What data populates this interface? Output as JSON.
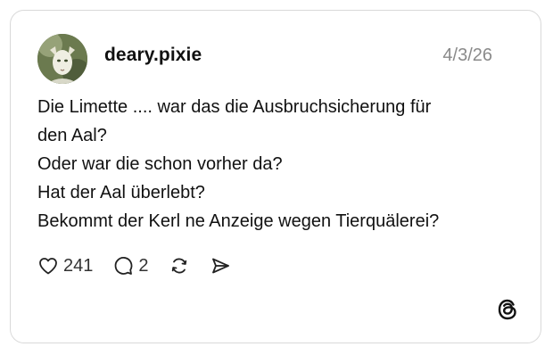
{
  "post": {
    "username": "deary.pixie",
    "date": "4/3/26",
    "lines": [
      "Die Limette .... war das die Ausbruchsicherung für",
      "den Aal?",
      "Oder war die schon vorher da?",
      "Hat der Aal überlebt?",
      "Bekommt der Kerl ne Anzeige wegen Tierquälerei?"
    ]
  },
  "actions": {
    "likes": "241",
    "replies": "2",
    "like_icon": "heart-icon",
    "reply_icon": "comment-icon",
    "repost_icon": "repost-icon",
    "share_icon": "send-icon"
  },
  "brand": {
    "logo_icon": "threads-logo-icon",
    "text_color": "#111111",
    "muted_color": "#8a8a8a",
    "border_color": "#d9d9d9"
  }
}
